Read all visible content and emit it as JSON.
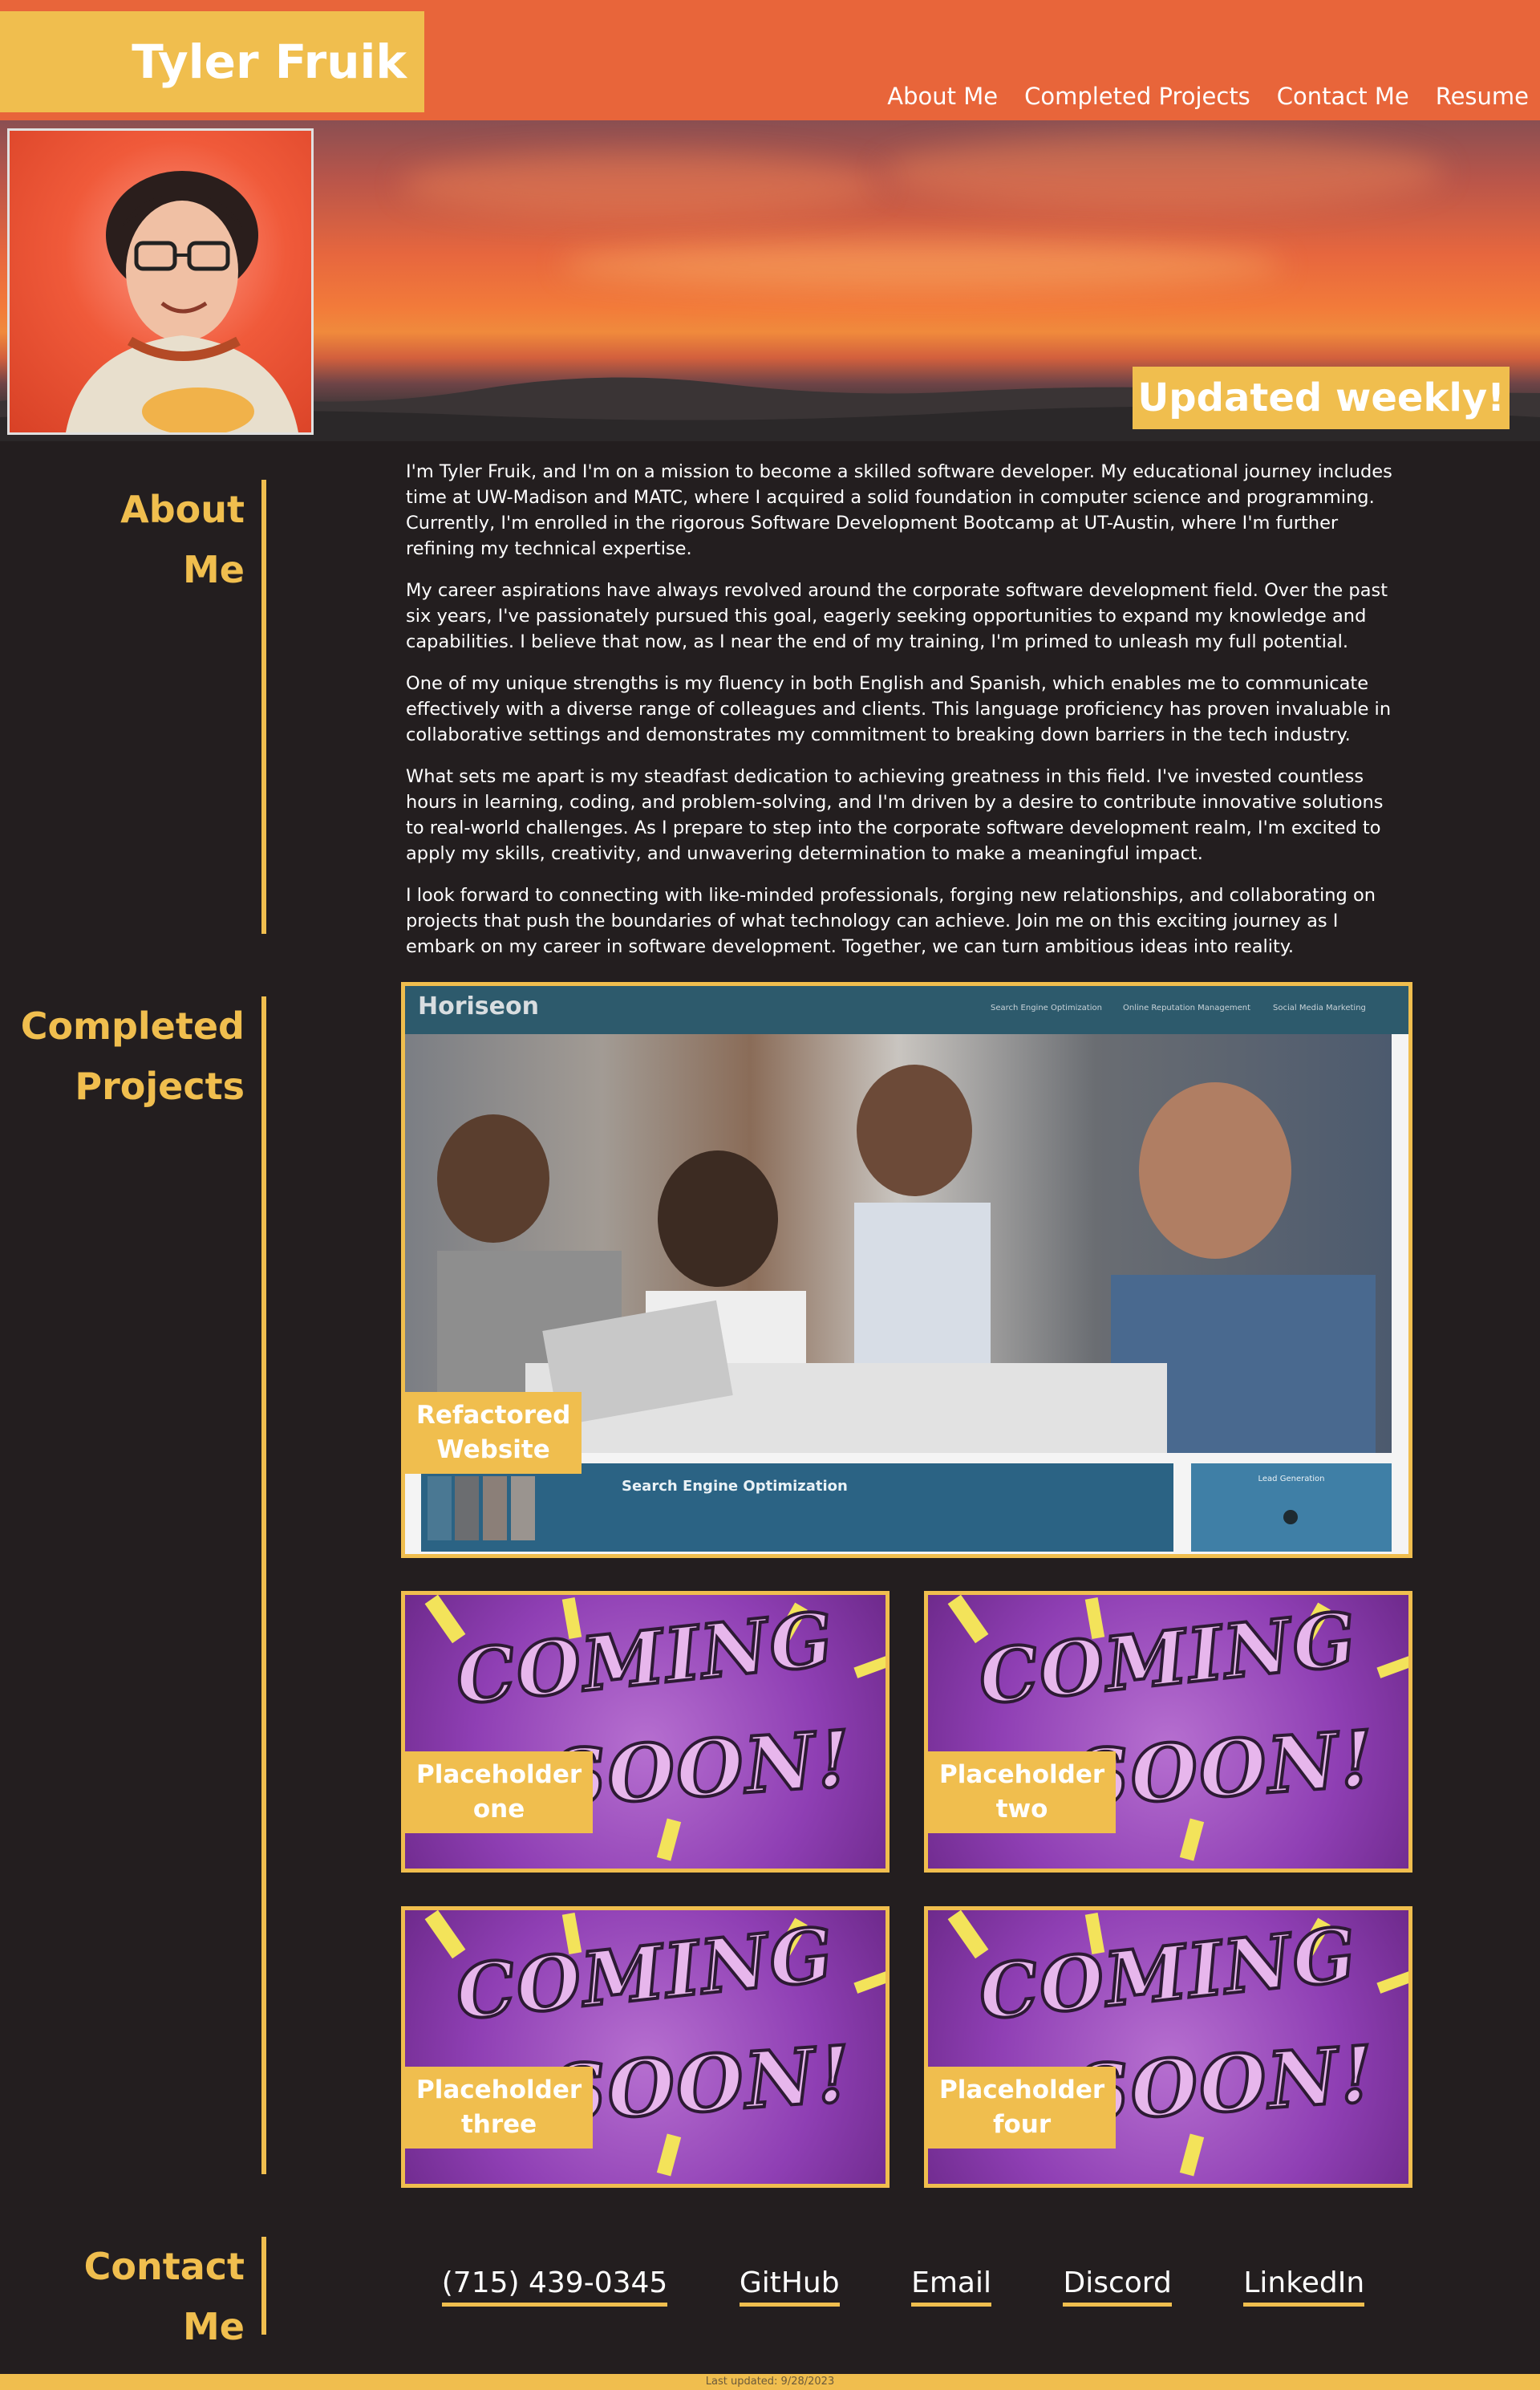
{
  "header": {
    "brand": "Tyler Fruik",
    "nav": [
      "About Me",
      "Completed Projects",
      "Contact Me",
      "Resume"
    ]
  },
  "hero": {
    "badge": "Updated weekly!",
    "avatar_icon": "profile-photo"
  },
  "about": {
    "title_line1": "About",
    "title_line2": "Me",
    "paragraphs": [
      "I'm Tyler Fruik, and I'm on a mission to become a skilled software developer. My educational journey includes time at UW-Madison and MATC, where I acquired a solid foundation in computer science and programming. Currently, I'm enrolled in the rigorous Software Development Bootcamp at UT-Austin, where I'm further refining my technical expertise.",
      "My career aspirations have always revolved around the corporate software development field. Over the past six years, I've passionately pursued this goal, eagerly seeking opportunities to expand my knowledge and capabilities. I believe that now, as I near the end of my training, I'm primed to unleash my full potential.",
      "One of my unique strengths is my fluency in both English and Spanish, which enables me to communicate effectively with a diverse range of colleagues and clients. This language proficiency has proven invaluable in collaborative settings and demonstrates my commitment to breaking down barriers in the tech industry.",
      "What sets me apart is my steadfast dedication to achieving greatness in this field. I've invested countless hours in learning, coding, and problem-solving, and I'm driven by a desire to contribute innovative solutions to real-world challenges. As I prepare to step into the corporate software development realm, I'm excited to apply my skills, creativity, and unwavering determination to make a meaningful impact.",
      "I look forward to connecting with like-minded professionals, forging new relationships, and collaborating on projects that push the boundaries of what technology can achieve. Join me on this exciting journey as I embark on my career in software development. Together, we can turn ambitious ideas into reality."
    ]
  },
  "projects": {
    "title_line1": "Completed",
    "title_line2": "Projects",
    "featured": {
      "label_line1": "Refactored",
      "label_line2": "Website",
      "site_name": "Horiseon",
      "site_nav": [
        "Search Engine Optimization",
        "Online Reputation Management",
        "Social Media Marketing"
      ],
      "panel_title": "Search Engine Optimization",
      "side_title": "Lead Generation"
    },
    "placeholders": [
      {
        "line1": "Placeholder",
        "line2": "one"
      },
      {
        "line1": "Placeholder",
        "line2": "two"
      },
      {
        "line1": "Placeholder",
        "line2": "three"
      },
      {
        "line1": "Placeholder",
        "line2": "four"
      }
    ],
    "coming_top": "COMING",
    "coming_bottom": "SOON!"
  },
  "contact": {
    "title_line1": "Contact",
    "title_line2": "Me",
    "links": [
      "(715) 439-0345",
      "GitHub",
      "Email",
      "Discord",
      "LinkedIn"
    ]
  },
  "footer": {
    "text": "Last updated: 9/28/2023"
  },
  "colors": {
    "header_bg": "#e8653a",
    "accent": "#f0be4e",
    "page_bg": "#231e1f"
  }
}
